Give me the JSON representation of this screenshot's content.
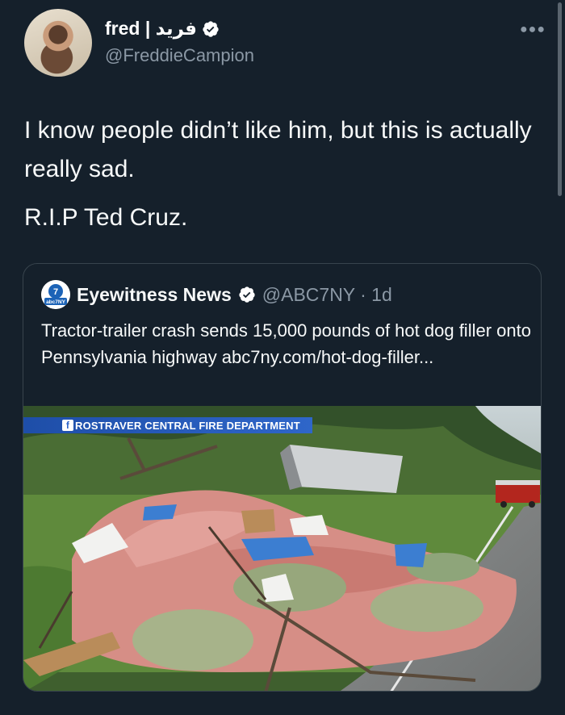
{
  "author": {
    "name": "fred | فريد",
    "handle": "@FreddieCampion"
  },
  "tweet": {
    "paragraphs": [
      "I know people didn’t like him, but this is actually really sad.",
      "R.I.P Ted Cruz."
    ]
  },
  "quoted": {
    "name": "Eyewitness News",
    "handle_time": "@ABC7NY · 1d",
    "text": "Tractor-trailer crash sends 15,000 pounds of hot dog filler onto Pennsylvania highway abc7ny.com/hot-dog-filler...",
    "logo_text": "abc7NY",
    "media": {
      "chyron": "ROSTRAVER CENTRAL FIRE DEPARTMENT",
      "chyron_icon": "f"
    }
  },
  "icons": {
    "verified": "verified-badge-icon",
    "more": "more-horizontal-icon"
  },
  "colors": {
    "background": "#15202b",
    "secondary_text": "#8b98a5",
    "border": "#38444d"
  }
}
